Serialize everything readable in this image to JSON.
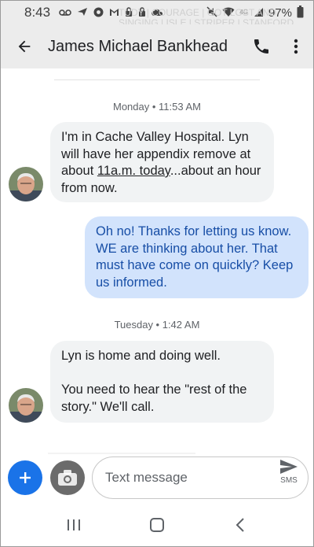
{
  "status_bar": {
    "time": "8:43",
    "battery": "97%",
    "network": "4G",
    "icons_left": [
      "voicemail-icon",
      "send-icon",
      "chrome-icon",
      "gmail-icon",
      "drive-icon",
      "lock-icon",
      "cloud-icon"
    ],
    "icons_right": [
      "mute-icon",
      "wifi-icon",
      "signal-icon",
      "battery-icon"
    ],
    "ghost_text": [
      "TUDY | COURAGE | GOT LOST AND",
      "SINGING | ISLE | STRIPER | STANFORD"
    ]
  },
  "app_bar": {
    "contact_name": "James Michael Bankhead",
    "back_icon": "arrow-back-icon",
    "call_icon": "phone-icon",
    "more_icon": "more-vert-icon"
  },
  "conversation": {
    "messages": [
      {
        "type": "timestamp",
        "text": "Monday • 11:53 AM"
      },
      {
        "type": "incoming",
        "text_before": "I'm in Cache Valley Hospital. Lyn will have her appendix remove at about ",
        "text_link": "11a.m. today",
        "text_after": "...about an hour from now."
      },
      {
        "type": "outgoing",
        "text": "Oh no! Thanks for letting us know. WE are thinking about her. That must have come on quickly? Keep us informed."
      },
      {
        "type": "timestamp",
        "text": "Tuesday • 1:42 AM"
      },
      {
        "type": "incoming",
        "text": "Lyn is home and doing well.\n\nYou need to hear the \"rest of the story.\" We'll call."
      }
    ]
  },
  "compose": {
    "placeholder": "Text message",
    "send_label": "SMS",
    "add_icon": "plus-icon",
    "media_icon": "camera-icon",
    "send_icon": "send-icon"
  },
  "nav_bar": {
    "buttons": [
      "recents-icon",
      "home-icon",
      "back-icon"
    ]
  },
  "colors": {
    "accent": "#1a73e8",
    "incoming_bubble": "#f1f3f4",
    "outgoing_bubble": "#d2e3fc",
    "outgoing_text": "#174ea6",
    "toolbar": "#ececec"
  }
}
